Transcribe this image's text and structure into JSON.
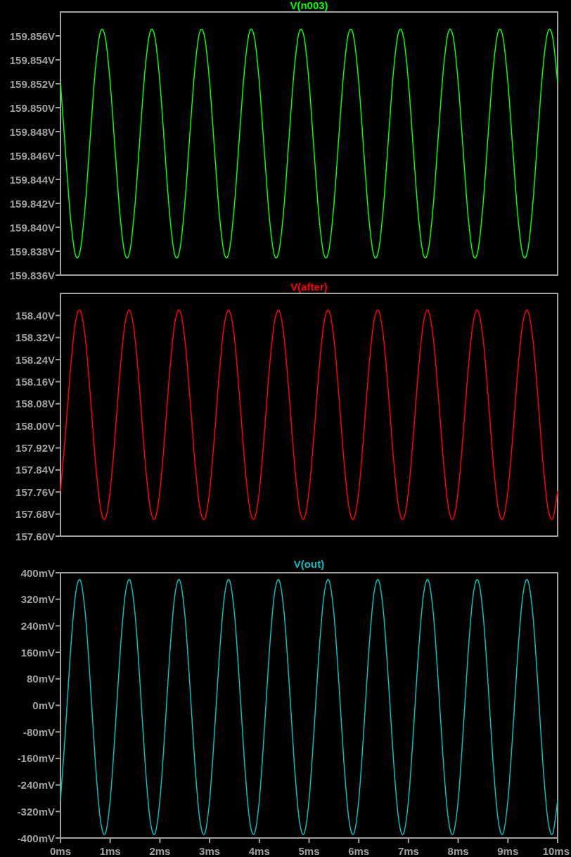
{
  "panes": [
    {
      "chart_data": {
        "type": "line",
        "x": [
          0,
          0.1,
          0.2,
          0.3,
          0.4,
          0.5,
          0.6,
          0.7,
          0.8,
          0.9,
          1,
          1.1,
          1.2,
          1.3,
          1.4,
          1.5,
          1.6,
          1.7,
          1.8,
          1.9,
          2,
          2.1,
          2.2,
          2.3,
          2.4,
          2.5,
          2.6,
          2.7,
          2.8,
          2.9,
          3,
          3.1,
          3.2,
          3.3,
          3.4,
          3.5,
          3.6,
          3.7,
          3.8,
          3.9,
          4,
          4.1,
          4.2,
          4.3,
          4.4,
          4.5,
          4.6,
          4.7,
          4.8,
          4.9,
          5,
          5.1,
          5.2,
          5.3,
          5.4,
          5.5,
          5.6,
          5.7,
          5.8,
          5.9,
          6,
          6.1,
          6.2,
          6.3,
          6.4,
          6.5,
          6.6,
          6.7,
          6.8,
          6.9,
          7,
          7.1,
          7.2,
          7.3,
          7.4,
          7.5,
          7.6,
          7.7,
          7.8,
          7.9,
          8,
          8.1,
          8.2,
          8.3,
          8.4,
          8.5,
          8.6,
          8.7,
          8.8,
          8.9,
          9,
          9.1,
          9.2,
          9.3,
          9.4,
          9.5,
          9.6,
          9.7,
          9.8,
          9.9,
          10
        ],
        "xlim": [
          0,
          10
        ],
        "ylim": [
          159.836,
          159.858
        ],
        "yticks": [
          {
            "value": 159.856,
            "label": "159.856V"
          },
          {
            "value": 159.854,
            "label": "159.854V"
          },
          {
            "value": 159.852,
            "label": "159.852V"
          },
          {
            "value": 159.85,
            "label": "159.850V"
          },
          {
            "value": 159.848,
            "label": "159.848V"
          },
          {
            "value": 159.846,
            "label": "159.846V"
          },
          {
            "value": 159.844,
            "label": "159.844V"
          },
          {
            "value": 159.842,
            "label": "159.842V"
          },
          {
            "value": 159.84,
            "label": "159.840V"
          },
          {
            "value": 159.838,
            "label": "159.838V"
          },
          {
            "value": 159.836,
            "label": "159.836V"
          }
        ],
        "series": [
          {
            "name": "V(n003)",
            "color": "#00ff00",
            "values": [
              159.8521,
              159.8464,
              159.8409,
              159.8377,
              159.8381,
              159.8419,
              159.8476,
              159.8531,
              159.8563,
              159.8559,
              159.8521,
              159.8464,
              159.8409,
              159.8377,
              159.8381,
              159.8419,
              159.8476,
              159.8531,
              159.8563,
              159.8559,
              159.8521,
              159.8464,
              159.8409,
              159.8377,
              159.8381,
              159.8419,
              159.8476,
              159.8531,
              159.8563,
              159.8559,
              159.8521,
              159.8464,
              159.8409,
              159.8377,
              159.8381,
              159.8419,
              159.8476,
              159.8531,
              159.8563,
              159.8559,
              159.8521,
              159.8464,
              159.8409,
              159.8377,
              159.8381,
              159.8419,
              159.8476,
              159.8531,
              159.8563,
              159.8559,
              159.8521,
              159.8464,
              159.8409,
              159.8377,
              159.8381,
              159.8419,
              159.8476,
              159.8531,
              159.8563,
              159.8559,
              159.8521,
              159.8464,
              159.8409,
              159.8377,
              159.8381,
              159.8419,
              159.8476,
              159.8531,
              159.8563,
              159.8559,
              159.8521,
              159.8464,
              159.8409,
              159.8377,
              159.8381,
              159.8419,
              159.8476,
              159.8531,
              159.8563,
              159.8559,
              159.8521,
              159.8464,
              159.8409,
              159.8377,
              159.8381,
              159.8419,
              159.8476,
              159.8531,
              159.8563,
              159.8559,
              159.8521,
              159.8464,
              159.8409,
              159.8377,
              159.8381,
              159.8419,
              159.8476,
              159.8531,
              159.8563,
              159.8559,
              159.8521
            ]
          }
        ]
      }
    },
    {
      "chart_data": {
        "type": "line",
        "x": [
          0,
          0.1,
          0.2,
          0.3,
          0.4,
          0.5,
          0.6,
          0.7,
          0.8,
          0.9,
          1,
          1.1,
          1.2,
          1.3,
          1.4,
          1.5,
          1.6,
          1.7,
          1.8,
          1.9,
          2,
          2.1,
          2.2,
          2.3,
          2.4,
          2.5,
          2.6,
          2.7,
          2.8,
          2.9,
          3,
          3.1,
          3.2,
          3.3,
          3.4,
          3.5,
          3.6,
          3.7,
          3.8,
          3.9,
          4,
          4.1,
          4.2,
          4.3,
          4.4,
          4.5,
          4.6,
          4.7,
          4.8,
          4.9,
          5,
          5.1,
          5.2,
          5.3,
          5.4,
          5.5,
          5.6,
          5.7,
          5.8,
          5.9,
          6,
          6.1,
          6.2,
          6.3,
          6.4,
          6.5,
          6.6,
          6.7,
          6.8,
          6.9,
          7,
          7.1,
          7.2,
          7.3,
          7.4,
          7.5,
          7.6,
          7.7,
          7.8,
          7.9,
          8,
          8.1,
          8.2,
          8.3,
          8.4,
          8.5,
          8.6,
          8.7,
          8.8,
          8.9,
          9,
          9.1,
          9.2,
          9.3,
          9.4,
          9.5,
          9.6,
          9.7,
          9.8,
          9.9,
          10
        ],
        "xlim": [
          0,
          10
        ],
        "ylim": [
          157.6,
          158.48
        ],
        "yticks": [
          {
            "value": 158.4,
            "label": "158.40V"
          },
          {
            "value": 158.32,
            "label": "158.32V"
          },
          {
            "value": 158.24,
            "label": "158.24V"
          },
          {
            "value": 158.16,
            "label": "158.16V"
          },
          {
            "value": 158.08,
            "label": "158.08V"
          },
          {
            "value": 158.0,
            "label": "158.00V"
          },
          {
            "value": 157.92,
            "label": "157.92V"
          },
          {
            "value": 157.84,
            "label": "157.84V"
          },
          {
            "value": 157.76,
            "label": "157.76V"
          },
          {
            "value": 157.68,
            "label": "157.68V"
          },
          {
            "value": 157.6,
            "label": "157.60V"
          }
        ],
        "series": [
          {
            "name": "V(after)",
            "color": "#ff0000",
            "values": [
              157.763,
              157.969,
              158.202,
              158.373,
              158.417,
              158.317,
              158.111,
              157.878,
              157.707,
              157.663,
              157.763,
              157.969,
              158.202,
              158.373,
              158.417,
              158.317,
              158.111,
              157.878,
              157.707,
              157.663,
              157.763,
              157.969,
              158.202,
              158.373,
              158.417,
              158.317,
              158.111,
              157.878,
              157.707,
              157.663,
              157.763,
              157.969,
              158.202,
              158.373,
              158.417,
              158.317,
              158.111,
              157.878,
              157.707,
              157.663,
              157.763,
              157.969,
              158.202,
              158.373,
              158.417,
              158.317,
              158.111,
              157.878,
              157.707,
              157.663,
              157.763,
              157.969,
              158.202,
              158.373,
              158.417,
              158.317,
              158.111,
              157.878,
              157.707,
              157.663,
              157.763,
              157.969,
              158.202,
              158.373,
              158.417,
              158.317,
              158.111,
              157.878,
              157.707,
              157.663,
              157.763,
              157.969,
              158.202,
              158.373,
              158.417,
              158.317,
              158.111,
              157.878,
              157.707,
              157.663,
              157.763,
              157.969,
              158.202,
              158.373,
              158.417,
              158.317,
              158.111,
              157.878,
              157.707,
              157.663,
              157.763,
              157.969,
              158.202,
              158.373,
              158.417,
              158.317,
              158.111,
              157.878,
              157.707,
              157.663,
              157.763
            ]
          }
        ]
      }
    },
    {
      "chart_data": {
        "type": "line",
        "x": [
          0,
          0.1,
          0.2,
          0.3,
          0.4,
          0.5,
          0.6,
          0.7,
          0.8,
          0.9,
          1,
          1.1,
          1.2,
          1.3,
          1.4,
          1.5,
          1.6,
          1.7,
          1.8,
          1.9,
          2,
          2.1,
          2.2,
          2.3,
          2.4,
          2.5,
          2.6,
          2.7,
          2.8,
          2.9,
          3,
          3.1,
          3.2,
          3.3,
          3.4,
          3.5,
          3.6,
          3.7,
          3.8,
          3.9,
          4,
          4.1,
          4.2,
          4.3,
          4.4,
          4.5,
          4.6,
          4.7,
          4.8,
          4.9,
          5,
          5.1,
          5.2,
          5.3,
          5.4,
          5.5,
          5.6,
          5.7,
          5.8,
          5.9,
          6,
          6.1,
          6.2,
          6.3,
          6.4,
          6.5,
          6.6,
          6.7,
          6.8,
          6.9,
          7,
          7.1,
          7.2,
          7.3,
          7.4,
          7.5,
          7.6,
          7.7,
          7.8,
          7.9,
          8,
          8.1,
          8.2,
          8.3,
          8.4,
          8.5,
          8.6,
          8.7,
          8.8,
          8.9,
          9,
          9.1,
          9.2,
          9.3,
          9.4,
          9.5,
          9.6,
          9.7,
          9.8,
          9.9,
          10
        ],
        "xlim": [
          0,
          10
        ],
        "ylim": [
          -400,
          400
        ],
        "xticks": [
          {
            "value": 0,
            "label": "0ms"
          },
          {
            "value": 1,
            "label": "1ms"
          },
          {
            "value": 2,
            "label": "2ms"
          },
          {
            "value": 3,
            "label": "3ms"
          },
          {
            "value": 4,
            "label": "4ms"
          },
          {
            "value": 5,
            "label": "5ms"
          },
          {
            "value": 6,
            "label": "6ms"
          },
          {
            "value": 7,
            "label": "7ms"
          },
          {
            "value": 8,
            "label": "8ms"
          },
          {
            "value": 9,
            "label": "9ms"
          },
          {
            "value": 10,
            "label": "10ms"
          }
        ],
        "yticks": [
          {
            "value": 400,
            "label": "400mV"
          },
          {
            "value": 320,
            "label": "320mV"
          },
          {
            "value": 240,
            "label": "240mV"
          },
          {
            "value": 160,
            "label": "160mV"
          },
          {
            "value": 80,
            "label": "80mV"
          },
          {
            "value": 0,
            "label": "0mV"
          },
          {
            "value": -80,
            "label": "-80mV"
          },
          {
            "value": -160,
            "label": "-160mV"
          },
          {
            "value": -240,
            "label": "-240mV"
          },
          {
            "value": -320,
            "label": "-320mV"
          },
          {
            "value": -400,
            "label": "-400mV"
          }
        ],
        "series": [
          {
            "name": "V(out)",
            "color": "#00c0c0",
            "values": [
              -286,
              -77,
              159,
              332,
              377,
              276,
              67,
              -169,
              -342,
              -387,
              -286,
              -77,
              159,
              332,
              377,
              276,
              67,
              -169,
              -342,
              -387,
              -286,
              -77,
              159,
              332,
              377,
              276,
              67,
              -169,
              -342,
              -387,
              -286,
              -77,
              159,
              332,
              377,
              276,
              67,
              -169,
              -342,
              -387,
              -286,
              -77,
              159,
              332,
              377,
              276,
              67,
              -169,
              -342,
              -387,
              -286,
              -77,
              159,
              332,
              377,
              276,
              67,
              -169,
              -342,
              -387,
              -286,
              -77,
              159,
              332,
              377,
              276,
              67,
              -169,
              -342,
              -387,
              -286,
              -77,
              159,
              332,
              377,
              276,
              67,
              -169,
              -342,
              -387,
              -286,
              -77,
              159,
              332,
              377,
              276,
              67,
              -169,
              -342,
              -387,
              -286,
              -77,
              159,
              332,
              377,
              276,
              67,
              -169,
              -342,
              -387,
              -286
            ]
          }
        ]
      }
    }
  ]
}
